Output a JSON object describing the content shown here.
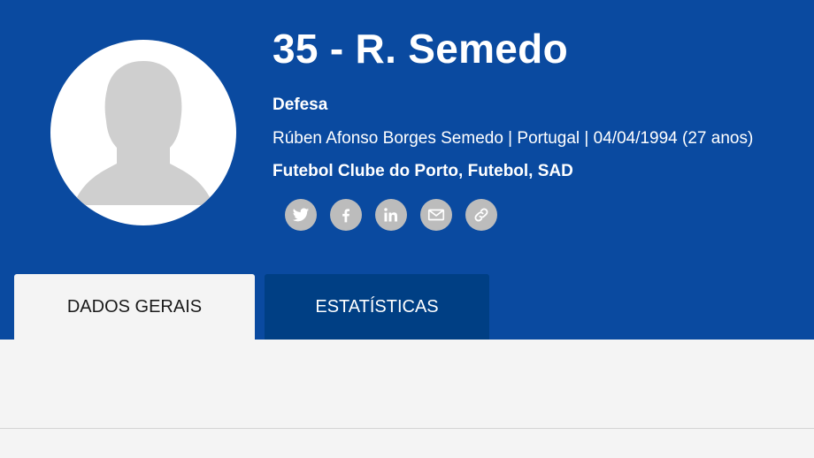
{
  "player": {
    "title": "35 - R. Semedo",
    "position": "Defesa",
    "details": "Rúben Afonso Borges Semedo | Portugal | 04/04/1994 (27 anos)",
    "club": "Futebol Clube do Porto, Futebol, SAD"
  },
  "social": [
    {
      "icon": "twitter-icon"
    },
    {
      "icon": "facebook-icon"
    },
    {
      "icon": "linkedin-icon"
    },
    {
      "icon": "email-icon"
    },
    {
      "icon": "link-icon"
    }
  ],
  "tabs": {
    "general": "DADOS GERAIS",
    "stats": "ESTATÍSTICAS"
  },
  "colors": {
    "header_bg": "#0a4aa0",
    "active_tab_bg": "#f4f4f4",
    "inactive_tab_bg": "#003f84",
    "social_icon_bg": "#bcbcbc",
    "avatar_silhouette": "#cfcfcf"
  }
}
